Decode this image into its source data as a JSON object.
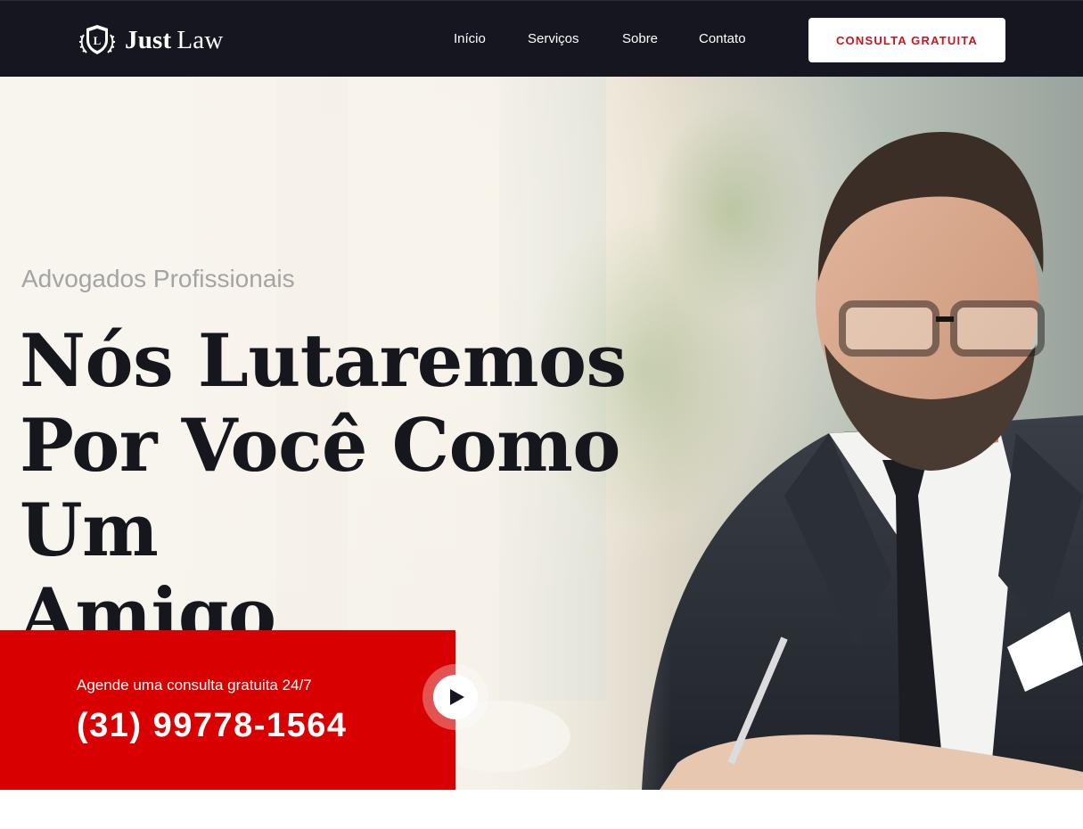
{
  "header": {
    "logo": {
      "word_bold": "Just",
      "word_regular": "Law",
      "emblem_letter": "L",
      "emblem_icon": "shield-laurel-icon"
    },
    "nav": [
      {
        "label": "Início"
      },
      {
        "label": "Serviços"
      },
      {
        "label": "Sobre"
      },
      {
        "label": "Contato"
      }
    ],
    "cta_label": "CONSULTA GRATUITA"
  },
  "hero": {
    "eyebrow": "Advogados Profissionais",
    "headline_lines": [
      "Nós Lutaremos",
      "Por Você Como Um",
      "Amigo"
    ],
    "background_image": "lawyer-portrait-photo"
  },
  "contact_box": {
    "subtitle": "Agende uma consulta gratuita 24/7",
    "phone": "(31) 99778-1564"
  },
  "video": {
    "icon": "play-icon"
  },
  "colors": {
    "header_bg": "#15161f",
    "accent_red": "#d80000",
    "cta_text": "#c9151e",
    "headline": "#16161d",
    "eyebrow": "#a4a4a4"
  }
}
